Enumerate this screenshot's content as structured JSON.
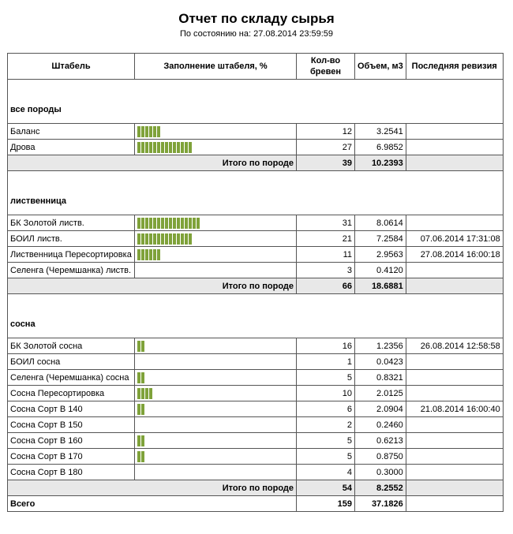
{
  "report": {
    "title": "Отчет по складу сырья",
    "subtitle": "По состоянию на: 27.08.2014 23:59:59"
  },
  "columns": {
    "stack": "Штабель",
    "fill": "Заполнение штабеля, %",
    "count_line1": "Кол-во",
    "count_line2": "бревен",
    "volume": "Объем, м3",
    "revision": "Последняя ревизия"
  },
  "groups": [
    {
      "name": "все породы",
      "rows": [
        {
          "name": "Баланс",
          "fill_segments": 6,
          "count": "12",
          "volume": "3.2541",
          "revision": ""
        },
        {
          "name": "Дрова",
          "fill_segments": 14,
          "count": "27",
          "volume": "6.9852",
          "revision": ""
        }
      ],
      "total_label": "Итого по породе",
      "total_count": "39",
      "total_volume": "10.2393"
    },
    {
      "name": "лиственница",
      "rows": [
        {
          "name": "БК Золотой листв.",
          "fill_segments": 16,
          "count": "31",
          "volume": "8.0614",
          "revision": ""
        },
        {
          "name": "БОИЛ листв.",
          "fill_segments": 14,
          "count": "21",
          "volume": "7.2584",
          "revision": "07.06.2014 17:31:08"
        },
        {
          "name": "Лиственница Пересортировка",
          "fill_segments": 6,
          "count": "11",
          "volume": "2.9563",
          "revision": "27.08.2014 16:00:18"
        },
        {
          "name": "Селенга (Черемшанка) листв.",
          "fill_segments": 0,
          "count": "3",
          "volume": "0.4120",
          "revision": ""
        }
      ],
      "total_label": "Итого по породе",
      "total_count": "66",
      "total_volume": "18.6881"
    },
    {
      "name": "сосна",
      "rows": [
        {
          "name": "БК Золотой сосна",
          "fill_segments": 2,
          "count": "16",
          "volume": "1.2356",
          "revision": "26.08.2014 12:58:58"
        },
        {
          "name": "БОИЛ сосна",
          "fill_segments": 0,
          "count": "1",
          "volume": "0.0423",
          "revision": ""
        },
        {
          "name": "Селенга (Черемшанка) сосна",
          "fill_segments": 2,
          "count": "5",
          "volume": "0.8321",
          "revision": ""
        },
        {
          "name": "Сосна Пересортировка",
          "fill_segments": 4,
          "count": "10",
          "volume": "2.0125",
          "revision": ""
        },
        {
          "name": "Сосна Сорт В 140",
          "fill_segments": 2,
          "count": "6",
          "volume": "2.0904",
          "revision": "21.08.2014 16:00:40"
        },
        {
          "name": "Сосна Сорт В 150",
          "fill_segments": 0,
          "count": "2",
          "volume": "0.2460",
          "revision": ""
        },
        {
          "name": "Сосна Сорт В 160",
          "fill_segments": 2,
          "count": "5",
          "volume": "0.6213",
          "revision": ""
        },
        {
          "name": "Сосна Сорт В 170",
          "fill_segments": 2,
          "count": "5",
          "volume": "0.8750",
          "revision": ""
        },
        {
          "name": "Сосна Сорт В 180",
          "fill_segments": 0,
          "count": "4",
          "volume": "0.3000",
          "revision": ""
        }
      ],
      "total_label": "Итого по породе",
      "total_count": "54",
      "total_volume": "8.2552"
    }
  ],
  "grand_total": {
    "label": "Всего",
    "count": "159",
    "volume": "37.1826"
  },
  "colors": {
    "fill_bar": "#7fa23a",
    "total_row_bg": "#e8e8e8"
  }
}
